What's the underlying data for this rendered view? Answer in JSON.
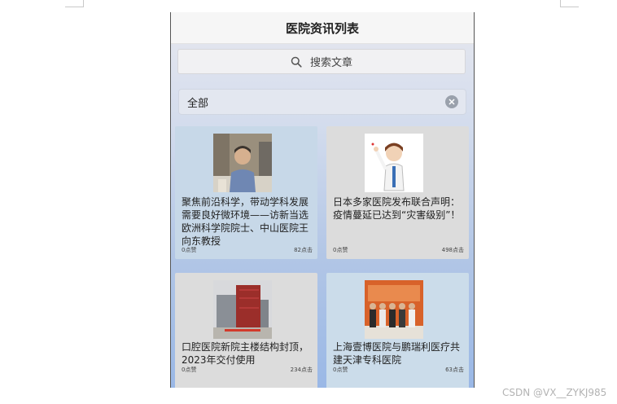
{
  "page": {
    "title": "医院资讯列表"
  },
  "search": {
    "placeholder": "搜索文章"
  },
  "filter": {
    "selected": "全部"
  },
  "articles": [
    {
      "title": "聚焦前沿科学，带动学科发展需要良好微环境——访新当选欧洲科学院院士、中山医院王向东教授",
      "likes": "0点赞",
      "clicks": "82点击",
      "image": "portrait-photo"
    },
    {
      "title": "日本多家医院发布联合声明：疫情蔓延已达到“灾害级别”！",
      "likes": "0点赞",
      "clicks": "498点击",
      "image": "doctor-illustration"
    },
    {
      "title": "口腔医院新院主楼结构封顶，2023年交付使用",
      "likes": "0点赞",
      "clicks": "234点击",
      "image": "building-photo"
    },
    {
      "title": "上海壹博医院与鹏瑞利医疗共建天津专科医院",
      "likes": "0点赞",
      "clicks": "63点击",
      "image": "group-photo"
    }
  ],
  "watermark": "CSDN @VX__ZYKJ985",
  "icons": {
    "search": "search-icon",
    "clear": "clear-icon"
  }
}
